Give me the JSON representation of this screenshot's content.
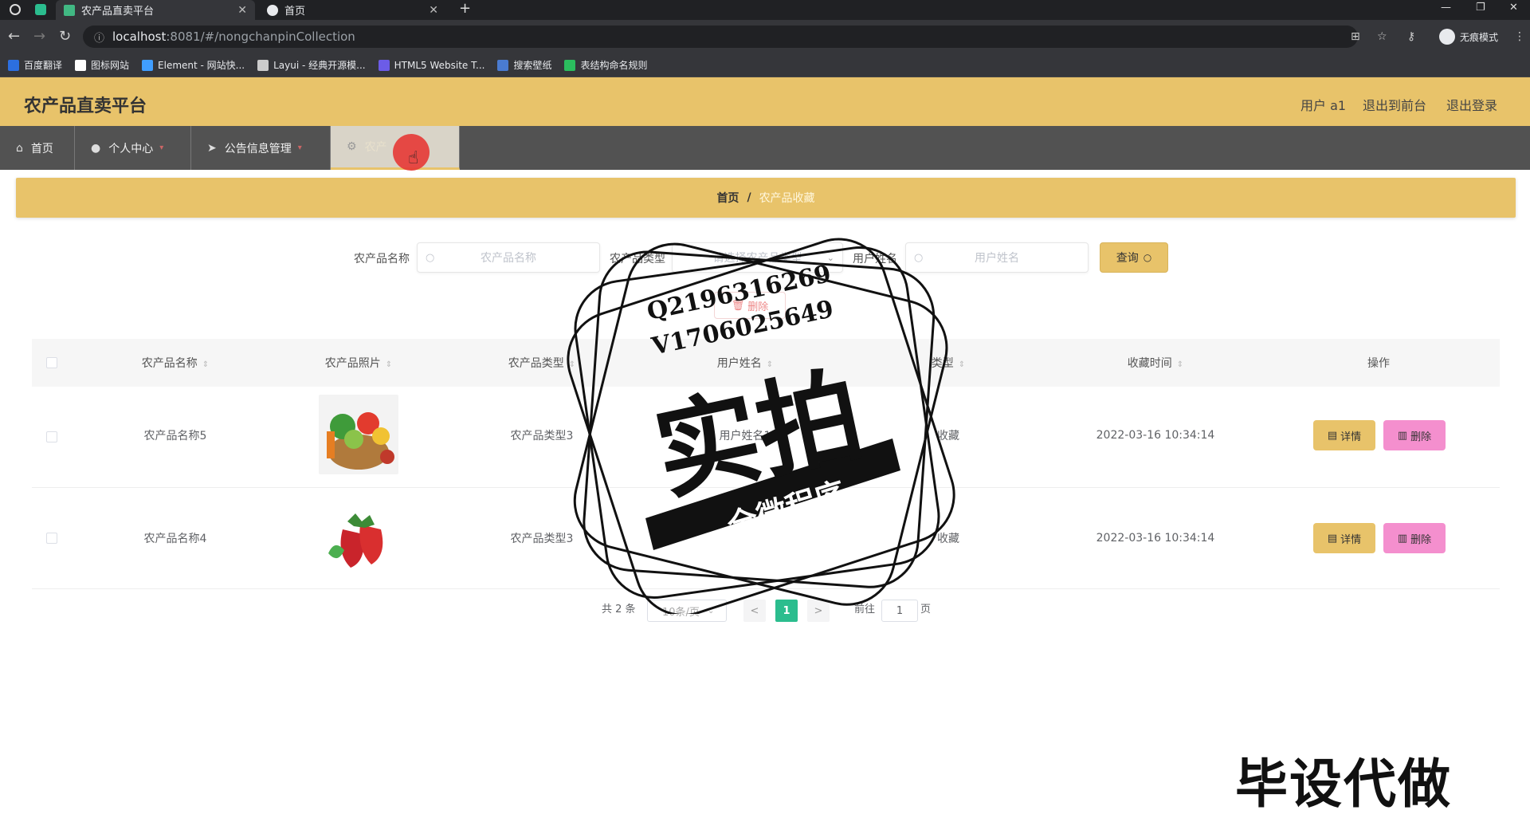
{
  "browser": {
    "tabs": [
      {
        "title": "农产品直卖平台",
        "active": true
      },
      {
        "title": "首页",
        "active": false
      }
    ],
    "new_tab": "+",
    "url_host": "localhost",
    "url_path": ":8081/#/nongchanpinCollection",
    "incognito_label": "无痕模式",
    "bookmarks": [
      "百度翻译",
      "图标网站",
      "Element - 网站快...",
      "Layui - 经典开源模...",
      "HTML5 Website T...",
      "搜索壁纸",
      "表结构命名规则"
    ]
  },
  "header": {
    "title": "农产品直卖平台",
    "user": "用户 a1",
    "to_front": "退出到前台",
    "logout": "退出登录"
  },
  "nav": {
    "items": [
      {
        "label": "首页",
        "icon": "home-icon"
      },
      {
        "label": "个人中心",
        "icon": "user-icon"
      },
      {
        "label": "公告信息管理",
        "icon": "megaphone-icon"
      },
      {
        "label": "农产",
        "icon": "gear-icon"
      }
    ]
  },
  "breadcrumb": {
    "home": "首页",
    "sep": "/",
    "current": "农产品收藏"
  },
  "search": {
    "name_label": "农产品名称",
    "name_placeholder": "农产品名称",
    "type_label": "农产品类型",
    "type_placeholder": "请选择农产品类型",
    "user_label": "用户姓名",
    "user_placeholder": "用户姓名",
    "query_button": "查询",
    "delete_button": "删除"
  },
  "table": {
    "headers": [
      "农产品名称",
      "农产品照片",
      "农产品类型",
      "用户姓名",
      "类型",
      "收藏时间",
      "操作"
    ],
    "rows": [
      {
        "name": "农产品名称5",
        "type": "农产品类型3",
        "user": "用户姓名1",
        "kind": "收藏",
        "time": "2022-03-16 10:34:14",
        "photo": "vegetable-basket"
      },
      {
        "name": "农产品名称4",
        "type": "农产品类型3",
        "user": "",
        "kind": "收藏",
        "time": "2022-03-16 10:34:14",
        "photo": "strawberries"
      }
    ],
    "detail_label": "详情",
    "delete_label": "删除"
  },
  "pagination": {
    "total": "共 2 条",
    "page_size": "10条/页",
    "prev": "<",
    "current": "1",
    "next": ">",
    "goto_label": "前往",
    "goto_value": "1",
    "page_suffix": "页"
  },
  "watermark": {
    "qq": "Q2196316269",
    "vx": "V1706025649",
    "big": "实拍",
    "ribbon": "全微程序",
    "corner": "毕设代做"
  }
}
